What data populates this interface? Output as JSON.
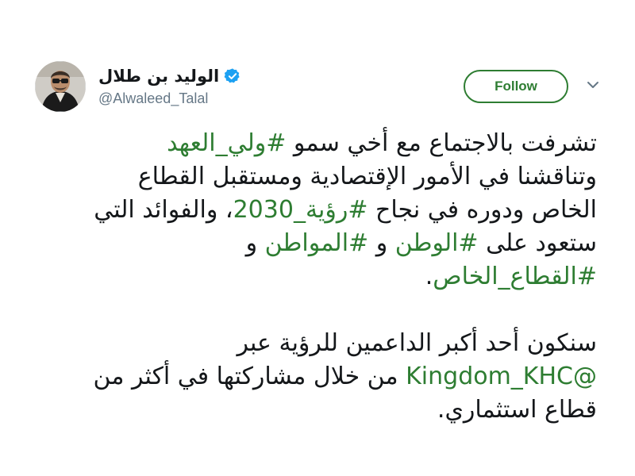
{
  "author": {
    "display_name": "الوليد بن طلال",
    "username": "@Alwaleed_Talal",
    "verified": true
  },
  "actions": {
    "follow_label": "Follow"
  },
  "icons": {
    "verified": "verified-badge-icon",
    "menu": "chevron-down-icon"
  },
  "colors": {
    "link_accent": "#2e7d32",
    "verified_badge": "#1da1f2",
    "text_primary": "#14171a",
    "text_secondary": "#657786"
  },
  "tweet": {
    "lines": [
      {
        "t1": "تشرفت بالاجتماع مع أخي سمو ",
        "h1": "#ولي_العهد"
      },
      {
        "t1": "وتناقشنا في الأمور الإقتصادية ومستقبل القطاع"
      },
      {
        "t1": "الخاص ودوره في نجاح ",
        "h1": "#رؤية_2030",
        "t2": "، والفوائد التي"
      },
      {
        "t1": "ستعود على ",
        "h1": "#الوطن",
        "t2": " و ",
        "h2": "#المواطن",
        "t3": " و"
      },
      {
        "h1": "#القطاع_الخاص",
        "t2": "."
      },
      {
        "t1": "سنكون أحد أكبر الداعمين للرؤية عبر"
      },
      {
        "m1": "@Kingdom_KHC",
        "t2": " من خلال مشاركتها في أكثر من"
      },
      {
        "t1": "قطاع استثماري."
      }
    ]
  }
}
